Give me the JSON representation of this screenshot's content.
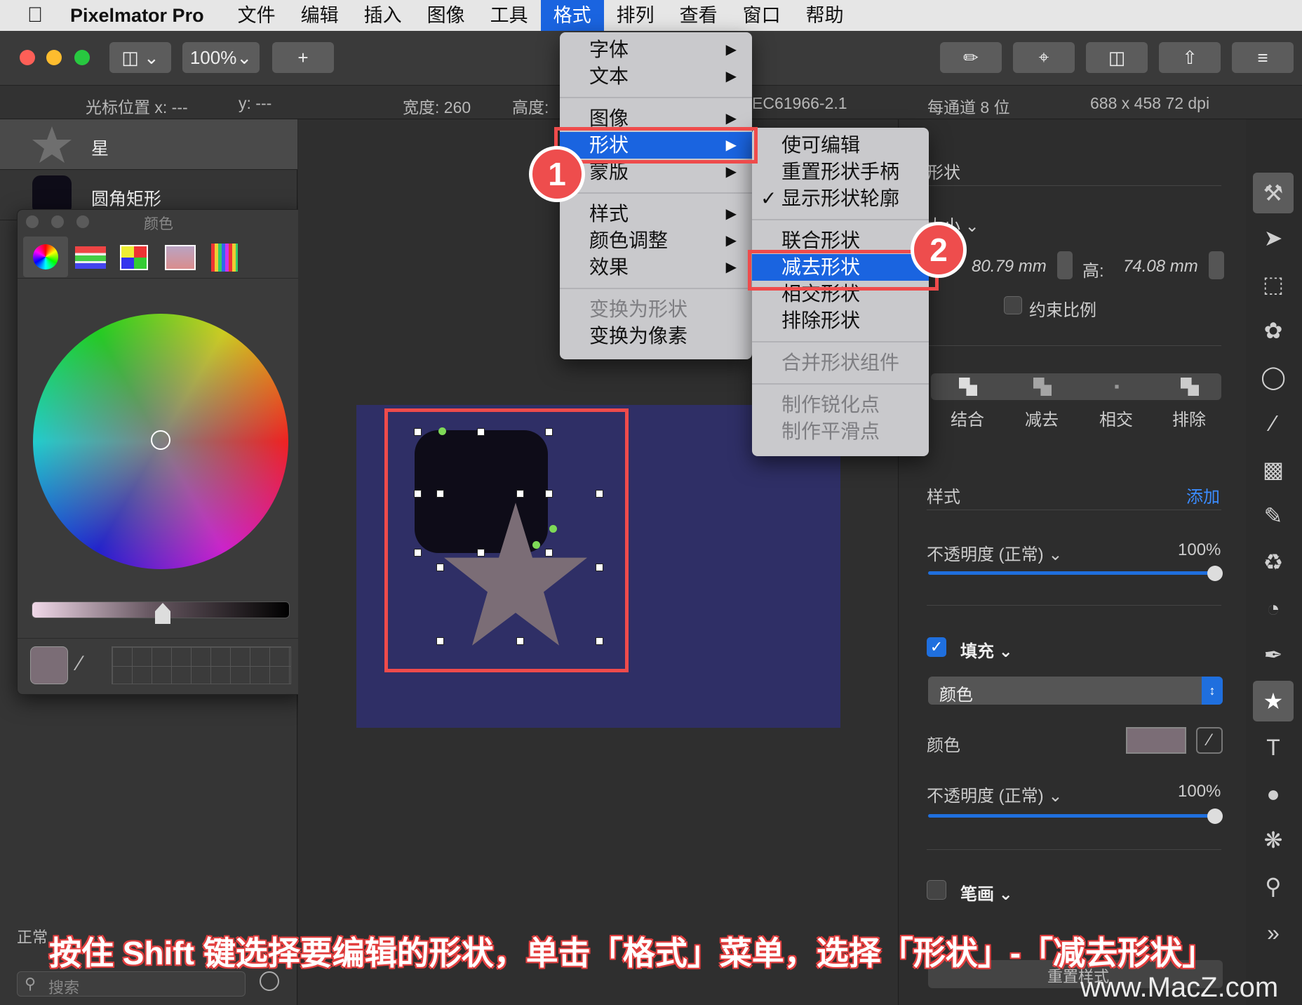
{
  "menubar": {
    "app_name": "Pixelmator Pro",
    "items": [
      "文件",
      "编辑",
      "插入",
      "图像",
      "工具",
      "格式",
      "排列",
      "查看",
      "窗口",
      "帮助"
    ],
    "active_index": 5
  },
  "toolbar": {
    "zoom": "100%",
    "add_label": "+"
  },
  "infobar": {
    "cursor_x": "光标位置 x:  ---",
    "cursor_y": "y:  ---",
    "width": "宽度:  260",
    "height": "高度:",
    "profile": "EC61966-2.1",
    "depth": "每通道 8 位",
    "dims": "688 x 458 72 dpi"
  },
  "layers": [
    {
      "name": "星"
    },
    {
      "name": "圆角矩形"
    }
  ],
  "color_window": {
    "title": "颜色"
  },
  "left_bottom": {
    "blend": "正常",
    "search_placeholder": "搜索"
  },
  "format_menu": {
    "items": [
      {
        "label": "字体",
        "arrow": true
      },
      {
        "label": "文本",
        "arrow": true
      },
      {
        "label": "图像",
        "arrow": true
      },
      {
        "label": "形状",
        "arrow": true,
        "selected": true
      },
      {
        "label": "蒙版",
        "arrow": true
      },
      {
        "label": "样式",
        "arrow": true
      },
      {
        "label": "颜色调整",
        "arrow": true
      },
      {
        "label": "效果",
        "arrow": true
      },
      {
        "label": "变换为形状",
        "disabled": true
      },
      {
        "label": "变换为像素"
      }
    ]
  },
  "shape_submenu": {
    "items": [
      {
        "label": "使可编辑"
      },
      {
        "label": "重置形状手柄"
      },
      {
        "label": "显示形状轮廓",
        "checked": true
      },
      {
        "label": "联合形状"
      },
      {
        "label": "减去形状",
        "selected": true
      },
      {
        "label": "相交形状"
      },
      {
        "label": "排除形状"
      },
      {
        "label": "合并形状组件",
        "disabled": true
      },
      {
        "label": "制作锐化点",
        "disabled": true
      },
      {
        "label": "制作平滑点",
        "disabled": true
      }
    ]
  },
  "badges": {
    "one": "1",
    "two": "2"
  },
  "right_panel": {
    "shape_header": "形状",
    "size_header": "大小",
    "width_value": "80.79 mm",
    "height_label": "高:",
    "height_value": "74.08 mm",
    "constrain": "约束比例",
    "ops": [
      "结合",
      "减去",
      "相交",
      "排除"
    ],
    "style_header": "样式",
    "add": "添加",
    "opacity_label": "不透明度 (正常)",
    "opacity_value": "100%",
    "fill_label": "填充",
    "fill_type": "颜色",
    "color_label": "颜色",
    "opacity2_label": "不透明度 (正常)",
    "opacity2_value": "100%",
    "stroke_label": "笔画",
    "reset_style": "重置样式"
  },
  "caption": "按住 Shift 键选择要编辑的形状，单击「格式」菜单，选择「形状」-「减去形状」",
  "watermark": "www.MacZ.com",
  "colors": {
    "accent": "#1a64e0",
    "highlight_red": "#ef4b4b",
    "canvas_bg": "#2f2f66",
    "star_fill": "#7b6d76",
    "rect_fill": "#0e0c18"
  }
}
